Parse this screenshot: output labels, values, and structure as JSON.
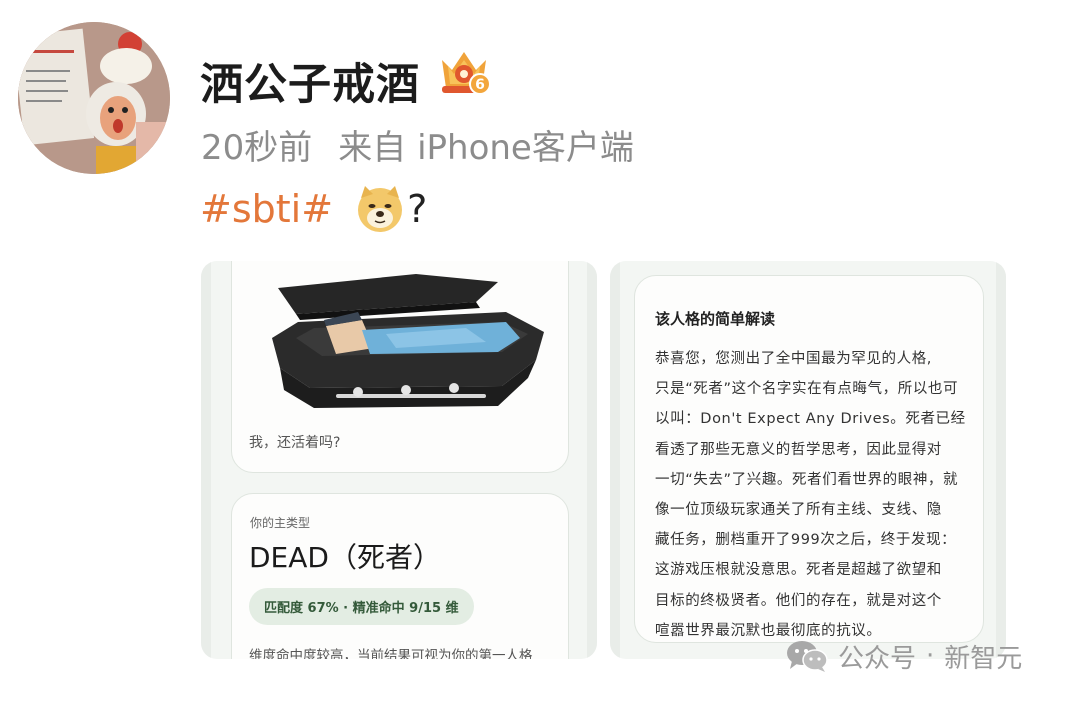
{
  "post": {
    "username": "洒公子戒酒",
    "time": "20秒前",
    "source": "来自 iPhone客户端",
    "hashtag": "#sbti#",
    "emoji": "doge-emoji",
    "trailing_text": "?"
  },
  "images": {
    "left": {
      "caption": "我，还活着吗?",
      "type_label": "你的主类型",
      "type_name": "DEAD（死者）",
      "match_badge": "匹配度 67% · 精准命中 9/15 维",
      "description": "维度命中度较高，当前结果可视为你的第一人格"
    },
    "right": {
      "title": "该人格的简单解读",
      "lines": [
        "恭喜您，您测出了全中国最为罕见的人格,",
        "只是“死者”这个名字实在有点晦气，所以也可",
        "以叫：Don't Expect Any Drives。死者已经",
        "看透了那些无意义的哲学思考，因此显得对",
        "一切“失去”了兴趣。死者们看世界的眼神，就",
        "像一位顶级玩家通关了所有主线、支线、隐",
        "藏任务，删档重开了999次之后，终于发现：",
        "这游戏压根就没意思。死者是超越了欲望和",
        "目标的终极贤者。他们的存在，就是对这个",
        "喧嚣世界最沉默也最彻底的抗议。"
      ]
    }
  },
  "watermark": {
    "platform": "公众号",
    "dot": "·",
    "account": "新智元"
  },
  "colors": {
    "hashtag": "#e3773a",
    "meta_text": "#8c8c8c",
    "card_bg": "#f3f6f3",
    "badge_bg": "#e3ede3"
  }
}
